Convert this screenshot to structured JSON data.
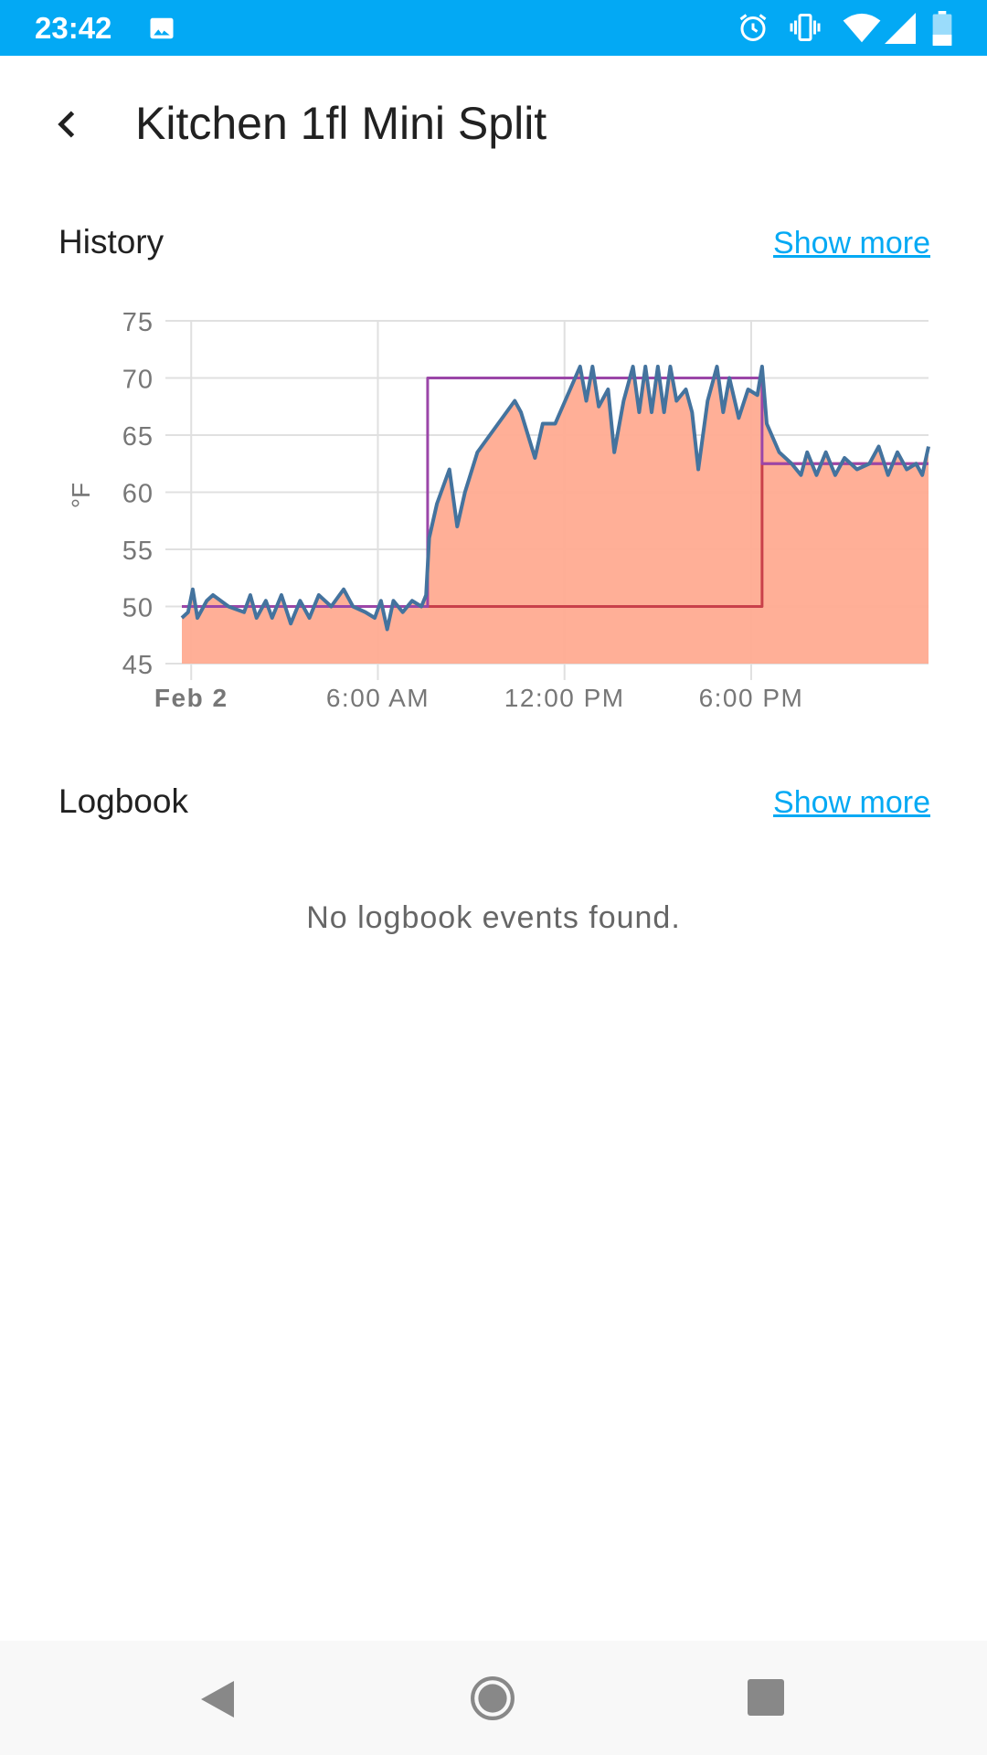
{
  "status_bar": {
    "time": "23:42",
    "icons": [
      "image-icon",
      "alarm-icon",
      "vibrate-icon",
      "wifi-icon",
      "signal-icon",
      "battery-icon"
    ],
    "color": "#03a9f4"
  },
  "header": {
    "title": "Kitchen 1fl Mini Split",
    "back_icon": "back-arrow-icon"
  },
  "history": {
    "title": "History",
    "show_more": "Show more"
  },
  "logbook": {
    "title": "Logbook",
    "show_more": "Show more",
    "empty_text": "No logbook events found."
  },
  "chart_data": {
    "type": "line",
    "ylabel": "°F",
    "ylim": [
      45,
      75
    ],
    "yticks": [
      "75",
      "70",
      "65",
      "60",
      "55",
      "50",
      "45"
    ],
    "xlim_hours": [
      -0.3,
      23.7
    ],
    "xticks": [
      {
        "hour": 0,
        "label": "Feb 2",
        "bold": true
      },
      {
        "hour": 6,
        "label": "6:00 AM"
      },
      {
        "hour": 12,
        "label": "12:00 PM"
      },
      {
        "hour": 18,
        "label": "6:00 PM"
      }
    ],
    "grid": true,
    "colors": {
      "current": "#44739e",
      "target_high": "#9b46a8",
      "target_low": "#c9404a",
      "fill": "#ffab91"
    },
    "series": {
      "current": [
        [
          -0.3,
          49
        ],
        [
          -0.1,
          49.5
        ],
        [
          0.05,
          51.5
        ],
        [
          0.2,
          49
        ],
        [
          0.5,
          50.5
        ],
        [
          0.7,
          51
        ],
        [
          1.2,
          50
        ],
        [
          1.7,
          49.5
        ],
        [
          1.9,
          51
        ],
        [
          2.1,
          49
        ],
        [
          2.4,
          50.5
        ],
        [
          2.6,
          49
        ],
        [
          2.9,
          51
        ],
        [
          3.2,
          48.5
        ],
        [
          3.5,
          50.5
        ],
        [
          3.8,
          49
        ],
        [
          4.1,
          51
        ],
        [
          4.5,
          50
        ],
        [
          4.9,
          51.5
        ],
        [
          5.2,
          50
        ],
        [
          5.6,
          49.5
        ],
        [
          5.9,
          49
        ],
        [
          6.1,
          50.5
        ],
        [
          6.3,
          48
        ],
        [
          6.5,
          50.5
        ],
        [
          6.8,
          49.5
        ],
        [
          7.1,
          50.5
        ],
        [
          7.4,
          50
        ],
        [
          7.55,
          51
        ],
        [
          7.65,
          56
        ],
        [
          7.9,
          59
        ],
        [
          8.3,
          62
        ],
        [
          8.55,
          57
        ],
        [
          8.8,
          60
        ],
        [
          9.2,
          63.5
        ],
        [
          9.6,
          65
        ],
        [
          10.0,
          66.5
        ],
        [
          10.4,
          68
        ],
        [
          10.6,
          67
        ],
        [
          11.05,
          63
        ],
        [
          11.3,
          66
        ],
        [
          11.7,
          66
        ],
        [
          12.1,
          68.5
        ],
        [
          12.5,
          71
        ],
        [
          12.7,
          68
        ],
        [
          12.9,
          71
        ],
        [
          13.1,
          67.5
        ],
        [
          13.4,
          69
        ],
        [
          13.6,
          63.5
        ],
        [
          13.9,
          68
        ],
        [
          14.2,
          71
        ],
        [
          14.4,
          67
        ],
        [
          14.6,
          71
        ],
        [
          14.8,
          67
        ],
        [
          15.0,
          71
        ],
        [
          15.2,
          67
        ],
        [
          15.4,
          71
        ],
        [
          15.6,
          68
        ],
        [
          15.9,
          69
        ],
        [
          16.1,
          67
        ],
        [
          16.3,
          62
        ],
        [
          16.6,
          68
        ],
        [
          16.9,
          71
        ],
        [
          17.1,
          67
        ],
        [
          17.3,
          70
        ],
        [
          17.6,
          66.5
        ],
        [
          17.9,
          69
        ],
        [
          18.2,
          68.5
        ],
        [
          18.35,
          71
        ],
        [
          18.5,
          66
        ],
        [
          18.9,
          63.5
        ],
        [
          19.3,
          62.5
        ],
        [
          19.6,
          61.5
        ],
        [
          19.8,
          63.5
        ],
        [
          20.1,
          61.5
        ],
        [
          20.4,
          63.5
        ],
        [
          20.7,
          61.5
        ],
        [
          21.0,
          63
        ],
        [
          21.4,
          62
        ],
        [
          21.8,
          62.5
        ],
        [
          22.1,
          64
        ],
        [
          22.4,
          61.5
        ],
        [
          22.7,
          63.5
        ],
        [
          23.0,
          62
        ],
        [
          23.3,
          62.5
        ],
        [
          23.5,
          61.5
        ],
        [
          23.7,
          64
        ]
      ],
      "target_high": [
        [
          -0.3,
          50
        ],
        [
          7.6,
          50
        ],
        [
          7.6,
          70
        ],
        [
          18.35,
          70
        ],
        [
          18.35,
          62.5
        ],
        [
          23.7,
          62.5
        ]
      ],
      "target_low": [
        [
          -0.3,
          50
        ],
        [
          18.35,
          50
        ],
        [
          18.35,
          62.5
        ],
        [
          23.7,
          62.5
        ]
      ]
    }
  }
}
